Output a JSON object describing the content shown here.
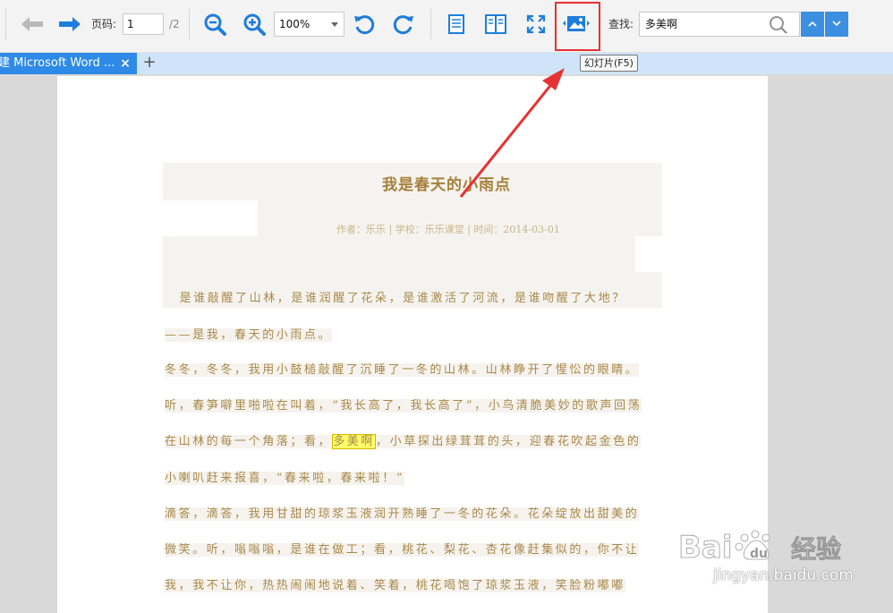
{
  "toolbar": {
    "page_label": "页码:",
    "page_value": "1",
    "page_total": "/2",
    "zoom_value": "100%",
    "search_label": "查找:",
    "search_value": "多美啊",
    "tooltip": "幻灯片(F5)"
  },
  "tabs": [
    {
      "label": "建 Microsoft Word ...",
      "close": "×"
    }
  ],
  "add_tab": "+",
  "document": {
    "title": "我是春天的小雨点",
    "meta": "作者：乐乐 | 学校：乐乐课堂 | 时间：2014-03-01",
    "lines": [
      "　是谁敲醒了山林，是谁润醒了花朵，是谁激活了河流，是谁吻醒了大地？",
      "——是我，春天的小雨点。",
      "冬冬，冬冬，我用小鼓槌敲醒了沉睡了一冬的山林。山林睁开了惺忪的眼睛。",
      "听，春笋噼里啪啦在叫着，“我长高了，我长高了”，小鸟清脆美妙的歌声回荡",
      "小喇叭赶来报喜，“春来啦，春来啦！”",
      "滴答，滴答，我用甘甜的琼浆玉液润开熟睡了一冬的花朵。花朵绽放出甜美的",
      "微笑。听，嗡嗡嗡，是谁在做工；看，桃花、梨花、杏花像赶集似的，你不让",
      "我，我不让你，热热闹闹地说着、笑着，桃花喝饱了琼浆玉液，笑脸粉嘟嘟"
    ],
    "line5_before": "在山林的每一个角落；看，",
    "line5_hit": "多美啊",
    "line5_after": "，小草探出绿茸茸的头，迎春花吹起金色的"
  },
  "watermark": {
    "brand": "Baidu",
    "brand_cn": "经验",
    "url": "jingyan.baidu.com"
  },
  "colors": {
    "accent": "#2e8ae6",
    "highlight_box": "#e53333",
    "arrow": "#e53333",
    "text": "#a8884a"
  }
}
